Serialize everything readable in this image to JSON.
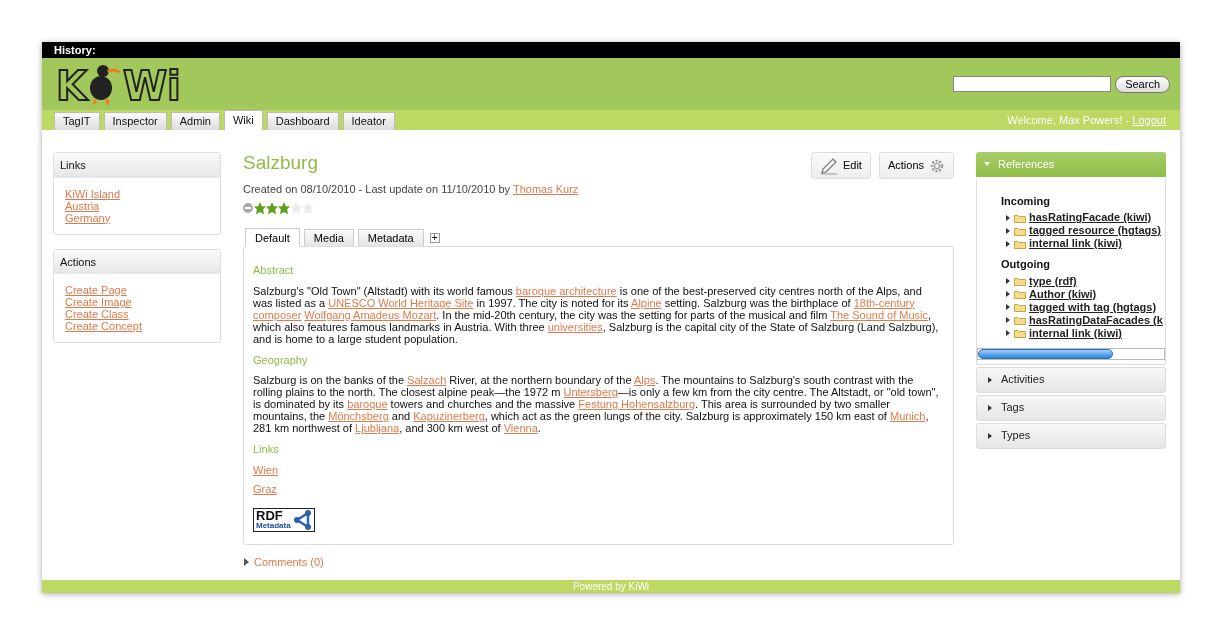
{
  "history_bar": {
    "label": "History:"
  },
  "logo": {
    "left": "K",
    "right": "Wi"
  },
  "search": {
    "button": "Search"
  },
  "nav_tabs": [
    {
      "label": "TagIT",
      "selected": false
    },
    {
      "label": "Inspector",
      "selected": false
    },
    {
      "label": "Admin",
      "selected": false
    },
    {
      "label": "Wiki",
      "selected": true
    },
    {
      "label": "Dashboard",
      "selected": false
    },
    {
      "label": "Ideator",
      "selected": false
    }
  ],
  "welcome": {
    "text": "Welcome, Max Powers! -",
    "logout": "Logout"
  },
  "sidebar_boxes": [
    {
      "title": "Links",
      "items": [
        "KiWi Island",
        "Austria",
        "Germany"
      ]
    },
    {
      "title": "Actions",
      "items": [
        "Create Page",
        "Create Image",
        "Create Class",
        "Create Concept"
      ]
    }
  ],
  "page": {
    "title": "Salzburg",
    "meta": "Created on 08/10/2010 - Last update on 11/10/2010 by",
    "author": "Thomas Kurz",
    "stars": 3,
    "buttons": [
      {
        "label": "Edit",
        "kind": "edit"
      },
      {
        "label": "Actions",
        "kind": "actions"
      }
    ]
  },
  "content_tabs": [
    {
      "label": "Default",
      "selected": true
    },
    {
      "label": "Media",
      "selected": false
    },
    {
      "label": "Metadata",
      "selected": false
    }
  ],
  "add_tab": "+",
  "article": [
    {
      "kind": "heading",
      "text": "Abstract"
    },
    {
      "kind": "paragraph",
      "parts": [
        {
          "kind": "text",
          "text": "Salzburg's \"Old Town\" (Altstadt) with its world famous "
        },
        {
          "kind": "link",
          "text": "baroque architecture"
        },
        {
          "kind": "text",
          "text": " is one of the best-preserved city centres north of the Alps, and was listed as a "
        },
        {
          "kind": "link",
          "text": "UNESCO World Heritage Site"
        },
        {
          "kind": "text",
          "text": " in 1997. The city is noted for its "
        },
        {
          "kind": "link",
          "text": "Alpine"
        },
        {
          "kind": "text",
          "text": " setting. Salzburg was the birthplace of "
        },
        {
          "kind": "link",
          "text": "18th-century"
        },
        {
          "kind": "link",
          "text": "composer"
        },
        {
          "kind": "link",
          "text": "Wolfgang Amadeus Mozart"
        },
        {
          "kind": "text",
          "text": ". In the mid-20th century, the city was the setting for parts of the musical and film "
        },
        {
          "kind": "link",
          "text": "The Sound of Music"
        },
        {
          "kind": "text",
          "text": ", which also features famous landmarks in Austria. With three "
        },
        {
          "kind": "link",
          "text": "universities"
        },
        {
          "kind": "text",
          "text": ", Salzburg is the capital city of the State of Salzburg (Land Salzburg), and is home to a large student population."
        }
      ]
    },
    {
      "kind": "heading",
      "text": "Geography"
    },
    {
      "kind": "paragraph",
      "parts": [
        {
          "kind": "text",
          "text": "Salzburg is on the banks of the "
        },
        {
          "kind": "link",
          "text": "Salzach"
        },
        {
          "kind": "text",
          "text": " River, at the northern boundary of the "
        },
        {
          "kind": "link",
          "text": "Alps"
        },
        {
          "kind": "text",
          "text": ". The mountains to Salzburg's south contrast with the rolling plains to the north. The closest alpine peak—the 1972 m "
        },
        {
          "kind": "link",
          "text": "Untersberg"
        },
        {
          "kind": "text",
          "text": "—is only a few km from the city centre. The Altstadt, or \"old town\", is dominated by its "
        },
        {
          "kind": "link",
          "text": "baroque"
        },
        {
          "kind": "text",
          "text": " towers and churches and the massive "
        },
        {
          "kind": "link",
          "text": "Festung Hohensalzburg"
        },
        {
          "kind": "text",
          "text": ". This area is surrounded by two smaller mountains, the "
        },
        {
          "kind": "link",
          "text": "Mönchsberg"
        },
        {
          "kind": "text",
          "text": " and "
        },
        {
          "kind": "link",
          "text": "Kapuzinerberg"
        },
        {
          "kind": "text",
          "text": ", which act as the green lungs of the city. Salzburg is approximately 150 km east of "
        },
        {
          "kind": "link",
          "text": "Munich"
        },
        {
          "kind": "text",
          "text": ", 281 km northwest of "
        },
        {
          "kind": "link",
          "text": "Ljubljana"
        },
        {
          "kind": "text",
          "text": ", and 300 km west of "
        },
        {
          "kind": "link",
          "text": "Vienna"
        },
        {
          "kind": "text",
          "text": "."
        }
      ]
    },
    {
      "kind": "heading",
      "text": "Links"
    },
    {
      "kind": "link",
      "text": "Wien"
    },
    {
      "kind": "link",
      "text": "Graz"
    },
    {
      "kind": "rdf",
      "title": "RDF",
      "subtitle": "Metadata"
    }
  ],
  "comments": "Comments (0)",
  "references": {
    "title": "References",
    "expanded": true,
    "groups": [
      {
        "title": "Incoming",
        "children": [
          {
            "label": "hasRatingFacade (kiwi)"
          },
          {
            "label": "tagged resource (hgtags)"
          },
          {
            "label": "internal link (kiwi)"
          }
        ]
      },
      {
        "title": "Outgoing",
        "children": [
          {
            "label": "type (rdf)"
          },
          {
            "label": "Author (kiwi)"
          },
          {
            "label": "tagged with tag (hgtags)"
          },
          {
            "label": "hasRatingDataFacades (k"
          },
          {
            "label": "internal link (kiwi)"
          }
        ]
      }
    ]
  },
  "panels": [
    {
      "title": "Activities",
      "expanded": false
    },
    {
      "title": "Tags",
      "expanded": false
    },
    {
      "title": "Types",
      "expanded": false
    }
  ],
  "footer": "Powered by KiWi"
}
